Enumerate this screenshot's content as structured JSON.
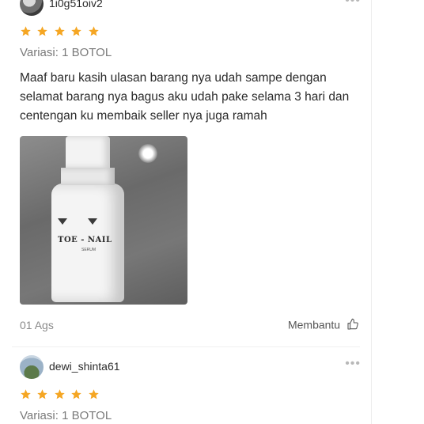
{
  "reviews": [
    {
      "username": "1i0g51oiv2",
      "rating": 5,
      "variant": "Variasi: 1 BOTOL",
      "text": "Maaf baru kasih ulasan barang nya udah sampe dengan selamat barang nya bagus aku udah pake selama 3 hari dan centengan ku membaik seller nya juga ramah",
      "photo_brand": "TOE - NAIL",
      "photo_sub": "SERUM",
      "date": "01 Ags",
      "helpful_label": "Membantu"
    },
    {
      "username": "dewi_shinta61",
      "rating": 5,
      "variant": "Variasi: 1 BOTOL"
    }
  ],
  "more_icon_glyph": "•••",
  "colors": {
    "star": "#f5a623",
    "helpful_icon": "#555555"
  },
  "icons": [
    "avatar",
    "more-options-icon",
    "star-icon",
    "thumbs-up-icon"
  ]
}
